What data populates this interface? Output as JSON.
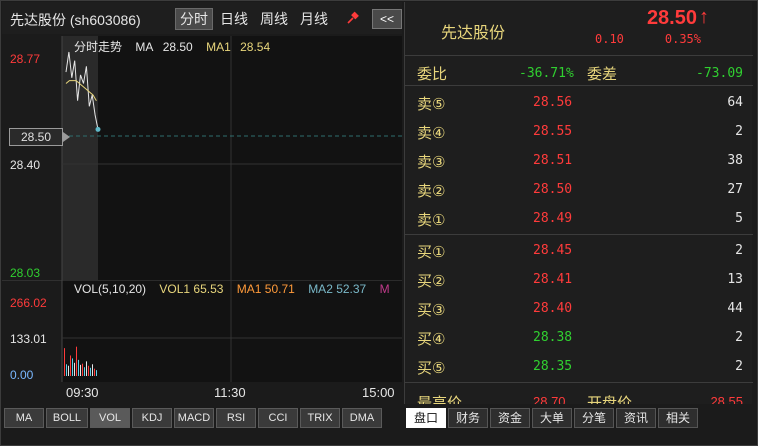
{
  "stock": {
    "title": "先达股份 (sh603086)",
    "name": "先达股份",
    "price": "28.50",
    "change": "0.10",
    "change_pct": "0.35%"
  },
  "period_tabs": [
    {
      "label": "分时",
      "active": true
    },
    {
      "label": "日线",
      "active": false
    },
    {
      "label": "周线",
      "active": false
    },
    {
      "label": "月线",
      "active": false
    }
  ],
  "collapse_label": "<<",
  "price_chart": {
    "legend_title": "分时走势",
    "ma_label": "MA",
    "ma_value": "28.50",
    "ma1_label": "MA1",
    "ma1_value": "28.54",
    "y_top": "28.77",
    "y_mid": "28.40",
    "y_bottom": "28.03",
    "current_tag": "28.50"
  },
  "vol_chart": {
    "legend_title": "VOL(5,10,20)",
    "vol1": "VOL1 65.53",
    "ma1": "MA1 50.71",
    "ma2": "MA2 52.37",
    "ma3_partial": "M",
    "y_top": "266.02",
    "y_mid": "133.01",
    "y_bottom": "0.00"
  },
  "x_axis": [
    "09:30",
    "11:30",
    "15:00"
  ],
  "indicator_tabs": [
    {
      "label": "MA",
      "active": false
    },
    {
      "label": "BOLL",
      "active": false
    },
    {
      "label": "VOL",
      "active": true
    },
    {
      "label": "KDJ",
      "active": false
    },
    {
      "label": "MACD",
      "active": false
    },
    {
      "label": "RSI",
      "active": false
    },
    {
      "label": "CCI",
      "active": false
    },
    {
      "label": "TRIX",
      "active": false
    },
    {
      "label": "DMA",
      "active": false
    }
  ],
  "weibi": {
    "label": "委比",
    "value": "-36.71%",
    "diff_label": "委差",
    "diff_value": "-73.09"
  },
  "asks": [
    {
      "level": "卖⑤",
      "price": "28.56",
      "qty": "64",
      "color": "red"
    },
    {
      "level": "卖④",
      "price": "28.55",
      "qty": "2",
      "color": "red"
    },
    {
      "level": "卖③",
      "price": "28.51",
      "qty": "38",
      "color": "red"
    },
    {
      "level": "卖②",
      "price": "28.50",
      "qty": "27",
      "color": "red"
    },
    {
      "level": "卖①",
      "price": "28.49",
      "qty": "5",
      "color": "red"
    }
  ],
  "bids": [
    {
      "level": "买①",
      "price": "28.45",
      "qty": "2",
      "color": "red"
    },
    {
      "level": "买②",
      "price": "28.41",
      "qty": "13",
      "color": "red"
    },
    {
      "level": "买③",
      "price": "28.40",
      "qty": "44",
      "color": "red"
    },
    {
      "level": "买④",
      "price": "28.38",
      "qty": "2",
      "color": "green"
    },
    {
      "level": "买⑤",
      "price": "28.35",
      "qty": "2",
      "color": "green"
    }
  ],
  "partial_row": {
    "left_label": "最高价",
    "left_value": "28.70",
    "right_label": "开盘价",
    "right_value": "28.55"
  },
  "right_tabs": [
    {
      "label": "盘口",
      "active": true
    },
    {
      "label": "财务",
      "active": false
    },
    {
      "label": "资金",
      "active": false
    },
    {
      "label": "大单",
      "active": false
    },
    {
      "label": "分笔",
      "active": false
    },
    {
      "label": "资讯",
      "active": false
    },
    {
      "label": "相关",
      "active": false
    }
  ],
  "colors": {
    "up": "#ff3b3b",
    "down": "#30d030",
    "label": "#e8d67c",
    "ma1_line": "#e8d67c",
    "ma2_line": "#7ab8c8",
    "ma3_line": "#c03a8a"
  },
  "chart_data": [
    {
      "type": "line",
      "title": "分时走势",
      "x": [
        "09:30",
        "11:30",
        "15:00"
      ],
      "ylim": [
        28.03,
        28.77
      ],
      "series": [
        {
          "name": "MA",
          "values": [
            28.7,
            28.77,
            28.68,
            28.74,
            28.6,
            28.69,
            28.66,
            28.72,
            28.58,
            28.62,
            28.55,
            28.5
          ]
        },
        {
          "name": "MA1",
          "values": [
            28.66,
            28.67,
            28.67,
            28.67,
            28.66,
            28.65,
            28.64,
            28.63,
            28.62,
            28.6
          ]
        }
      ]
    },
    {
      "type": "bar",
      "title": "VOL(5,10,20)",
      "ylim": [
        0,
        266.02
      ],
      "values": [
        95,
        40,
        35,
        70,
        60,
        45,
        100,
        55,
        38,
        42,
        30,
        50,
        35,
        28,
        40,
        25,
        20
      ]
    }
  ]
}
